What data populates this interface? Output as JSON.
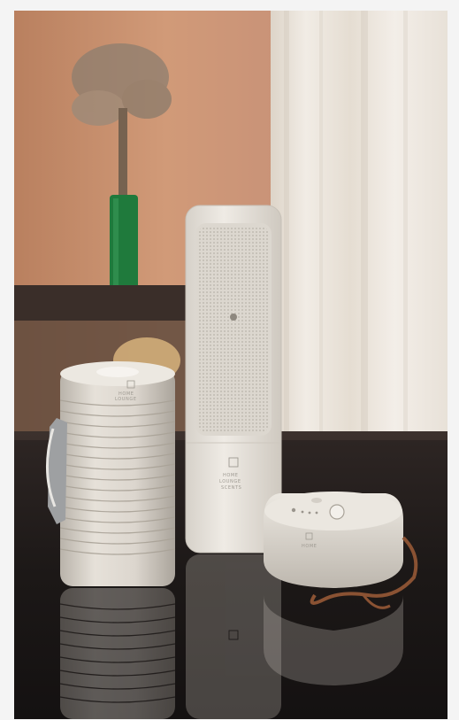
{
  "photo": {
    "subject": "home-fragrance-product-set",
    "colors": {
      "wall_warm": "#c9926e",
      "curtain": "#ece6de",
      "table_dark": "#1f1b1a",
      "device": "#e2ddd5",
      "vase_green": "#1c7a3a",
      "strap": "#8a5233"
    },
    "branding": {
      "line1": "HOME",
      "line2": "LOUNGE",
      "line3": "SCENTS"
    }
  }
}
